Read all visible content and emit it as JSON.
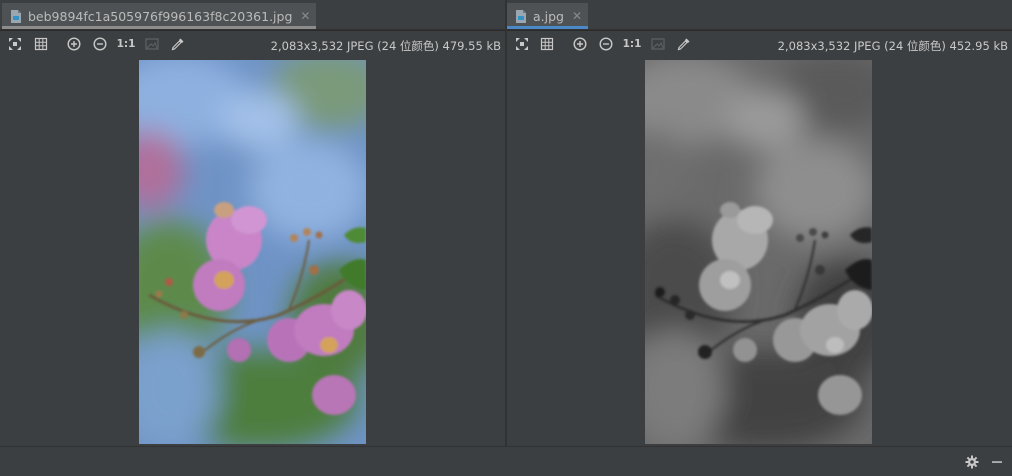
{
  "left_pane": {
    "tab": {
      "filename": "beb9894fc1a505976f996163f8c20361.jpg",
      "close_glyph": "✕",
      "icon": "image-file-icon"
    },
    "toolbar": {
      "icons": [
        "fit-zoom-icon",
        "grid-icon",
        "zoom-in-icon",
        "zoom-out-icon",
        "actual-size",
        "background-icon",
        "color-picker-icon"
      ],
      "actual_size_label": "1:1"
    },
    "info": "2,083x3,532 JPEG (24 位颜色) 479.55 kB",
    "image": {
      "alt": "Color photo of pink crape myrtle flowers against blue sky and green foliage"
    }
  },
  "right_pane": {
    "tab": {
      "filename": "a.jpg",
      "close_glyph": "✕",
      "icon": "image-file-icon"
    },
    "toolbar": {
      "icons": [
        "fit-zoom-icon",
        "grid-icon",
        "zoom-in-icon",
        "zoom-out-icon",
        "actual-size",
        "background-icon",
        "color-picker-icon"
      ],
      "actual_size_label": "1:1"
    },
    "info": "2,083x3,532 JPEG (24 位颜色) 452.95 kB",
    "image": {
      "alt": "Grayscale version of the crape myrtle photo"
    }
  },
  "statusbar": {
    "icons": [
      "gear-icon",
      "minimize-icon"
    ]
  },
  "colors": {
    "background": "#3c3f41",
    "tab_active": "#4e5254",
    "tab_selected_underline": "#4a88c7",
    "tab_inactive_underline": "#8c8c8c",
    "text": "#bbbbbb"
  }
}
